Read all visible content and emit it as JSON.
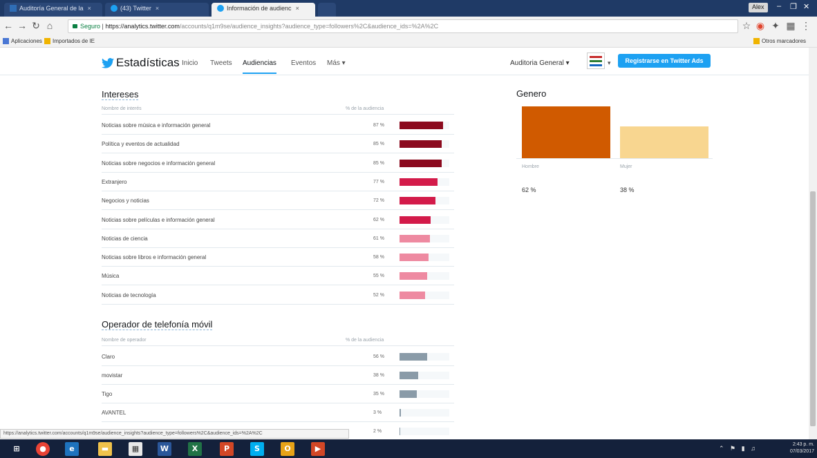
{
  "browser": {
    "tabs": [
      {
        "label": "Auditoría General de la",
        "active": false
      },
      {
        "label": "(43) Twitter",
        "active": false
      },
      {
        "label": "Información de audienc",
        "active": true
      }
    ],
    "profile": "Alex",
    "url": {
      "secure_label": "Seguro",
      "host": "https://analytics.twitter.com",
      "path": "/accounts/q1m9se/audience_insights?audience_type=followers%2C&audience_ids=%2A%2C"
    },
    "bookmarks": {
      "apps": "Aplicaciones",
      "imported": "Importados de IE",
      "others": "Otros marcadores"
    }
  },
  "header": {
    "brand": "Estadísticas",
    "nav": [
      "Inicio",
      "Tweets",
      "Audiencias",
      "Eventos",
      "Más ▾"
    ],
    "active_nav": "Audiencias",
    "account": "Auditoria General ▾",
    "ads_button": "Registrarse en Twitter Ads"
  },
  "interests": {
    "title": "Intereses",
    "col_name": "Nombre de interés",
    "col_pct": "% de la audiencia",
    "rows": [
      {
        "label": "Noticias sobre música e información general",
        "pct": "87 %",
        "value": 87,
        "color": "#8b0a1e"
      },
      {
        "label": "Política y eventos de actualidad",
        "pct": "85 %",
        "value": 85,
        "color": "#8b0a1e"
      },
      {
        "label": "Noticias sobre negocios e información general",
        "pct": "85 %",
        "value": 85,
        "color": "#8b0a1e"
      },
      {
        "label": "Extranjero",
        "pct": "77 %",
        "value": 77,
        "color": "#d31b4a"
      },
      {
        "label": "Negocios y noticias",
        "pct": "72 %",
        "value": 72,
        "color": "#d31b4a"
      },
      {
        "label": "Noticias sobre películas e información general",
        "pct": "62 %",
        "value": 62,
        "color": "#d31b4a"
      },
      {
        "label": "Noticias de ciencia",
        "pct": "61 %",
        "value": 61,
        "color": "#ee8aa1"
      },
      {
        "label": "Noticias sobre libros e información general",
        "pct": "58 %",
        "value": 58,
        "color": "#ee8aa1"
      },
      {
        "label": "Música",
        "pct": "55 %",
        "value": 55,
        "color": "#ee8aa1"
      },
      {
        "label": "Noticias de tecnología",
        "pct": "52 %",
        "value": 52,
        "color": "#ee8aa1"
      }
    ]
  },
  "carriers": {
    "title": "Operador de telefonía móvil",
    "col_name": "Nombre de operador",
    "col_pct": "% de la audiencia",
    "rows": [
      {
        "label": "Claro",
        "pct": "56 %",
        "value": 56,
        "color": "#8a9ba8"
      },
      {
        "label": "movistar",
        "pct": "38 %",
        "value": 38,
        "color": "#8a9ba8"
      },
      {
        "label": "Tigo",
        "pct": "35 %",
        "value": 35,
        "color": "#8a9ba8"
      },
      {
        "label": "AVANTEL",
        "pct": "3 %",
        "value": 3,
        "color": "#8a9ba8"
      },
      {
        "label": "",
        "pct": "2 %",
        "value": 2,
        "color": "#8a9ba8"
      }
    ]
  },
  "gender": {
    "title": "Genero",
    "items": [
      {
        "label": "Hombre",
        "pct": "62 %",
        "value": 62,
        "color": "#d05a00"
      },
      {
        "label": "Mujer",
        "pct": "38 %",
        "value": 38,
        "color": "#f8d690"
      }
    ]
  },
  "status_url": "https://analytics.twitter.com/accounts/q1m9se/audience_insights?audience_type=followers%2C&audience_ids=%2A%2C",
  "taskbar": {
    "time": "2:43 p. m.",
    "date": "07/03/2017"
  }
}
